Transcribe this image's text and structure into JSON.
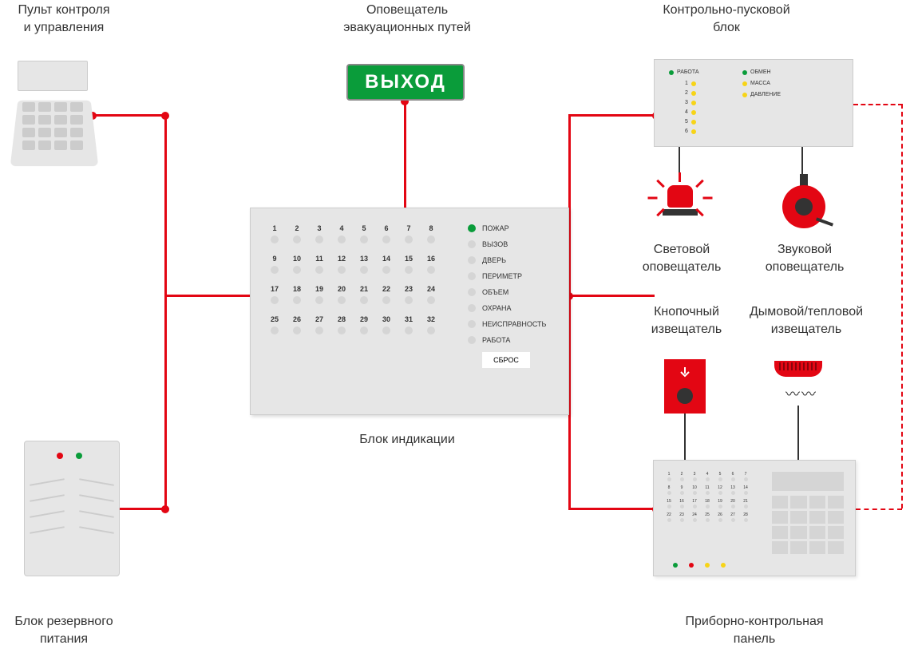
{
  "labels": {
    "control_console": "Пульт контроля\nи управления",
    "evacuation_notifier": "Оповещатель\nэвакуационных путей",
    "exit_sign": "ВЫХОД",
    "control_launch_block": "Контрольно-пусковой\nблок",
    "indication_block": "Блок индикации",
    "backup_power": "Блок резервного\nпитания",
    "light_notifier": "Световой\nоповещатель",
    "sound_notifier": "Звуковой\nоповещатель",
    "button_detector": "Кнопочный\nизвещатель",
    "smoke_heat_detector": "Дымовой/тепловой\nизвещатель",
    "control_panel": "Приборно-контрольная\nпанель"
  },
  "ctrl_block": {
    "left_labels": [
      "РАБОТА",
      "1",
      "2",
      "3",
      "4",
      "5",
      "6"
    ],
    "right_labels": [
      "ОБМЕН",
      "МАССА",
      "ДАВЛЕНИЕ"
    ]
  },
  "ind_block": {
    "numbers": [
      "1",
      "2",
      "3",
      "4",
      "5",
      "6",
      "7",
      "8",
      "9",
      "10",
      "11",
      "12",
      "13",
      "14",
      "15",
      "16",
      "17",
      "18",
      "19",
      "20",
      "21",
      "22",
      "23",
      "24",
      "25",
      "26",
      "27",
      "28",
      "29",
      "30",
      "31",
      "32"
    ],
    "statuses": [
      "ПОЖАР",
      "ВЫЗОВ",
      "ДВЕРЬ",
      "ПЕРИМЕТР",
      "ОБЪЕМ",
      "ОХРАНА",
      "НЕИСПРАВНОСТЬ",
      "РАБОТА"
    ],
    "reset": "СБРОС"
  },
  "panel": {
    "numbers": [
      "1",
      "2",
      "3",
      "4",
      "5",
      "6",
      "7",
      "8",
      "9",
      "10",
      "11",
      "12",
      "13",
      "14",
      "15",
      "16",
      "17",
      "18",
      "19",
      "20",
      "21",
      "22",
      "23",
      "24",
      "25",
      "26",
      "27",
      "28"
    ]
  },
  "colors": {
    "red": "#e30613",
    "green": "#0a9c3a",
    "yellow": "#f7d417"
  }
}
